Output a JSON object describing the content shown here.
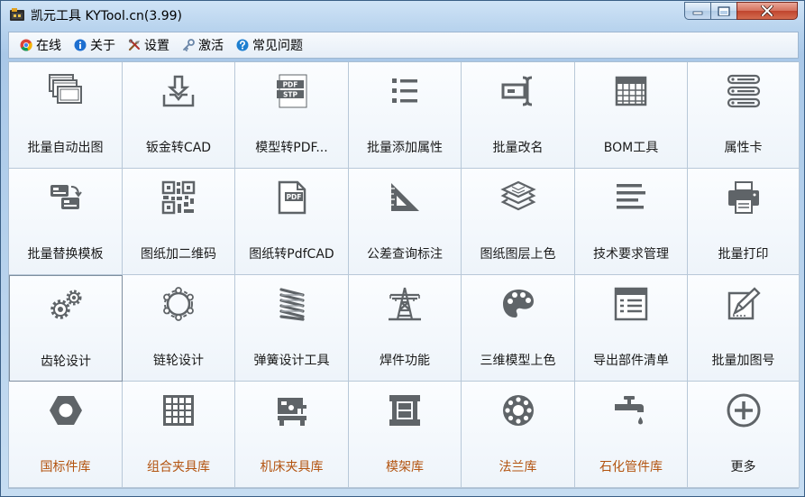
{
  "window": {
    "title": "凯元工具 KYTool.cn(3.99)"
  },
  "menu": [
    {
      "name": "menu-online",
      "label": "在线",
      "icon": "chrome-icon"
    },
    {
      "name": "menu-about",
      "label": "关于",
      "icon": "info-icon"
    },
    {
      "name": "menu-settings",
      "label": "设置",
      "icon": "tools-icon"
    },
    {
      "name": "menu-activate",
      "label": "激活",
      "icon": "key-icon"
    },
    {
      "name": "menu-faq",
      "label": "常见问题",
      "icon": "help-icon"
    }
  ],
  "tiles": [
    {
      "label": "批量自动出图",
      "icon": "stacked-drawings-icon",
      "category": "tool"
    },
    {
      "label": "钣金转CAD",
      "icon": "sheet-metal-icon",
      "category": "tool"
    },
    {
      "label": "模型转PDF...",
      "icon": "pdf-stp-icon",
      "category": "tool"
    },
    {
      "label": "批量添加属性",
      "icon": "bullet-list-icon",
      "category": "tool"
    },
    {
      "label": "批量改名",
      "icon": "rename-icon",
      "category": "tool"
    },
    {
      "label": "BOM工具",
      "icon": "bom-table-icon",
      "category": "tool"
    },
    {
      "label": "属性卡",
      "icon": "property-card-icon",
      "category": "tool"
    },
    {
      "label": "批量替换模板",
      "icon": "replace-template-icon",
      "category": "tool"
    },
    {
      "label": "图纸加二维码",
      "icon": "qr-code-icon",
      "category": "tool"
    },
    {
      "label": "图纸转PdfCAD",
      "icon": "pdf-document-icon",
      "category": "tool"
    },
    {
      "label": "公差查询标注",
      "icon": "set-square-icon",
      "category": "tool"
    },
    {
      "label": "图纸图层上色",
      "icon": "layers-icon",
      "category": "tool"
    },
    {
      "label": "技术要求管理",
      "icon": "text-lines-icon",
      "category": "tool"
    },
    {
      "label": "批量打印",
      "icon": "printer-icon",
      "category": "tool"
    },
    {
      "label": "齿轮设计",
      "icon": "gears-icon",
      "category": "tool"
    },
    {
      "label": "链轮设计",
      "icon": "sprocket-icon",
      "category": "tool"
    },
    {
      "label": "弹簧设计工具",
      "icon": "spring-icon",
      "category": "tool"
    },
    {
      "label": "焊件功能",
      "icon": "tower-icon",
      "category": "tool"
    },
    {
      "label": "三维模型上色",
      "icon": "palette-icon",
      "category": "tool"
    },
    {
      "label": "导出部件清单",
      "icon": "parts-list-icon",
      "category": "tool"
    },
    {
      "label": "批量加图号",
      "icon": "edit-icon",
      "category": "tool"
    },
    {
      "label": "国标件库",
      "icon": "hex-nut-icon",
      "category": "library"
    },
    {
      "label": "组合夹具库",
      "icon": "grid-plate-icon",
      "category": "library"
    },
    {
      "label": "机床夹具库",
      "icon": "machine-tool-icon",
      "category": "library"
    },
    {
      "label": "模架库",
      "icon": "mold-base-icon",
      "category": "library"
    },
    {
      "label": "法兰库",
      "icon": "flange-icon",
      "category": "library"
    },
    {
      "label": "石化管件库",
      "icon": "faucet-icon",
      "category": "library"
    },
    {
      "label": "更多",
      "icon": "plus-circle-icon",
      "category": "more"
    }
  ],
  "selected_tile_index": 14,
  "colors": {
    "icon_gray": "#5f6468",
    "library_label": "#b35410",
    "close_button": "#c9503a"
  }
}
